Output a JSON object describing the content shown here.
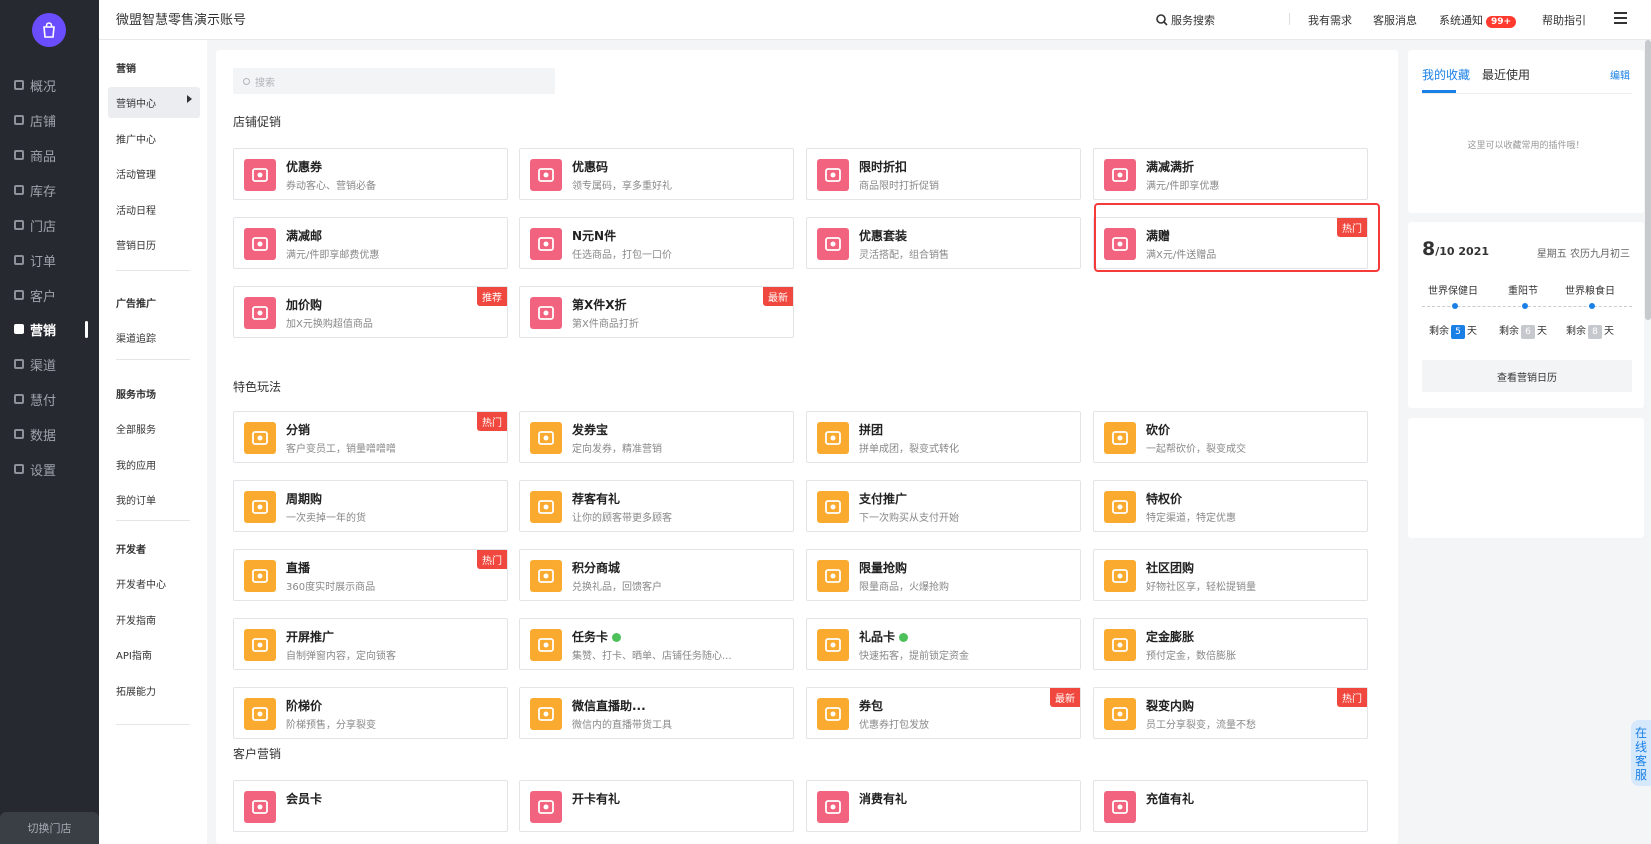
{
  "header": {
    "shop_name": "微盟智慧零售演示账号",
    "nav": [
      "服务搜索",
      "我有需求",
      "客服消息",
      "系统通知",
      "帮助指引"
    ],
    "notification_badge": "99+"
  },
  "rail": {
    "items": [
      "概况",
      "店铺",
      "商品",
      "库存",
      "门店",
      "订单",
      "客户",
      "营销",
      "渠道",
      "慧付",
      "数据",
      "设置"
    ],
    "active": "营销",
    "bottom": "切换门店"
  },
  "submenu": {
    "groups": [
      {
        "title": "营销",
        "items": [
          "营销中心",
          "推广中心",
          "活动管理",
          "活动日程",
          "营销日历"
        ]
      },
      {
        "title": "广告推广",
        "items": [
          "渠道追踪"
        ]
      },
      {
        "title": "服务市场",
        "items": [
          "全部服务",
          "我的应用",
          "我的订单"
        ]
      },
      {
        "title": "开发者",
        "items": [
          "开发者中心",
          "开发指南",
          "API指南",
          "拓展能力"
        ]
      }
    ]
  },
  "main": {
    "search_placeholder": "搜索",
    "sections": [
      {
        "title": "店铺促销",
        "cards": [
          {
            "title": "优惠券",
            "desc": "券动客心、营销必备",
            "icon": "coupon-icon",
            "color": "pink"
          },
          {
            "title": "优惠码",
            "desc": "领专属码，享多重好礼",
            "icon": "qrcode-icon",
            "color": "pink"
          },
          {
            "title": "限时折扣",
            "desc": "商品限时打折促销",
            "icon": "alarm-clock-icon",
            "color": "pink"
          },
          {
            "title": "满减满折",
            "desc": "满元/件即享优惠",
            "icon": "percent-icon",
            "color": "pink"
          },
          {
            "title": "满减邮",
            "desc": "满元/件即享邮费优惠",
            "icon": "shipping-icon",
            "color": "pink"
          },
          {
            "title": "N元N件",
            "desc": "任选商品，打包一口价",
            "icon": "bundle-price-icon",
            "color": "pink"
          },
          {
            "title": "优惠套装",
            "desc": "灵活搭配，组合销售",
            "icon": "package-icon",
            "color": "pink"
          },
          {
            "title": "满赠",
            "desc": "满X元/件送赠品",
            "icon": "gift-bag-icon",
            "color": "pink",
            "tag": "热门"
          },
          {
            "title": "加价购",
            "desc": "加X元换购超值商品",
            "icon": "add-buy-icon",
            "color": "pink",
            "tag": "推荐"
          },
          {
            "title": "第X件X折",
            "desc": "第X件商品打折",
            "icon": "discount-basket-icon",
            "color": "pink",
            "tag": "最新"
          }
        ]
      },
      {
        "title": "特色玩法",
        "cards": [
          {
            "title": "分销",
            "desc": "客户变员工，销量噌噌噌",
            "icon": "distribution-icon",
            "color": "orange",
            "tag": "热门"
          },
          {
            "title": "发券宝",
            "desc": "定向发券，精准营销",
            "icon": "coupon-issue-icon",
            "color": "orange"
          },
          {
            "title": "拼团",
            "desc": "拼单成团，裂变式转化",
            "icon": "group-buy-icon",
            "color": "orange"
          },
          {
            "title": "砍价",
            "desc": "一起帮砍价，裂变成交",
            "icon": "bargain-icon",
            "color": "orange"
          },
          {
            "title": "周期购",
            "desc": "一次卖掉一年的货",
            "icon": "cycle-buy-icon",
            "color": "orange"
          },
          {
            "title": "荐客有礼",
            "desc": "让你的顾客带更多顾客",
            "icon": "referral-icon",
            "color": "orange"
          },
          {
            "title": "支付推广",
            "desc": "下一次购买从支付开始",
            "icon": "payment-promo-icon",
            "color": "orange"
          },
          {
            "title": "特权价",
            "desc": "特定渠道，特定优惠",
            "icon": "privilege-price-icon",
            "color": "orange"
          },
          {
            "title": "直播",
            "desc": "360度实时展示商品",
            "icon": "live-tv-icon",
            "color": "orange",
            "tag": "热门"
          },
          {
            "title": "积分商城",
            "desc": "兑换礼品，回馈客户",
            "icon": "points-mall-icon",
            "color": "orange"
          },
          {
            "title": "限量抢购",
            "desc": "限量商品，火爆抢购",
            "icon": "flash-sale-icon",
            "color": "orange"
          },
          {
            "title": "社区团购",
            "desc": "好物社区享，轻松提销量",
            "icon": "community-icon",
            "color": "orange"
          },
          {
            "title": "开屏推广",
            "desc": "自制弹窗内容，定向锁客",
            "icon": "splash-promo-icon",
            "color": "orange"
          },
          {
            "title": "任务卡",
            "desc": "集赞、打卡、晒单、店铺任务随心...",
            "icon": "task-card-icon",
            "color": "orange",
            "verified": true
          },
          {
            "title": "礼品卡",
            "desc": "快速拓客，提前锁定资金",
            "icon": "gift-card-icon",
            "color": "orange",
            "verified": true
          },
          {
            "title": "定金膨胀",
            "desc": "预付定金，数倍膨胀",
            "icon": "deposit-icon",
            "color": "orange"
          },
          {
            "title": "阶梯价",
            "desc": "阶梯预售，分享裂变",
            "icon": "tier-price-icon",
            "color": "orange"
          },
          {
            "title": "微信直播助...",
            "desc": "微信内的直播带货工具",
            "icon": "wechat-live-icon",
            "color": "orange"
          },
          {
            "title": "券包",
            "desc": "优惠券打包发放",
            "icon": "coupon-pack-icon",
            "color": "orange",
            "tag": "最新"
          },
          {
            "title": "裂变内购",
            "desc": "员工分享裂变，流量不愁",
            "icon": "fission-icon",
            "color": "orange",
            "tag": "热门"
          }
        ]
      },
      {
        "title": "客户营销",
        "cards": [
          {
            "title": "会员卡",
            "desc": "",
            "icon": "member-card-icon",
            "color": "pink"
          },
          {
            "title": "开卡有礼",
            "desc": "",
            "icon": "open-card-gift-icon",
            "color": "pink"
          },
          {
            "title": "消费有礼",
            "desc": "",
            "icon": "consume-gift-icon",
            "color": "pink"
          },
          {
            "title": "充值有礼",
            "desc": "",
            "icon": "recharge-gift-icon",
            "color": "pink"
          }
        ]
      }
    ]
  },
  "right": {
    "tabs": [
      "我的收藏",
      "最近使用"
    ],
    "edit": "编辑",
    "empty_text": "这里可以收藏常用的插件哦！",
    "calendar": {
      "day": "8",
      "month_year": "/10 2021",
      "weekday_lunar": "星期五 农历九月初三",
      "festivals": [
        {
          "name": "世界保健日",
          "prefix": "剩余",
          "days": "5",
          "suffix": "天",
          "color": "#1a80e6"
        },
        {
          "name": "重阳节",
          "prefix": "剩余",
          "days": "6",
          "suffix": "天",
          "color": "#c5c8cd"
        },
        {
          "name": "世界粮食日",
          "prefix": "剩余",
          "days": "8",
          "suffix": "天",
          "color": "#c5c8cd"
        }
      ],
      "button": "查看营销日历"
    }
  },
  "online_service": "在线客服"
}
